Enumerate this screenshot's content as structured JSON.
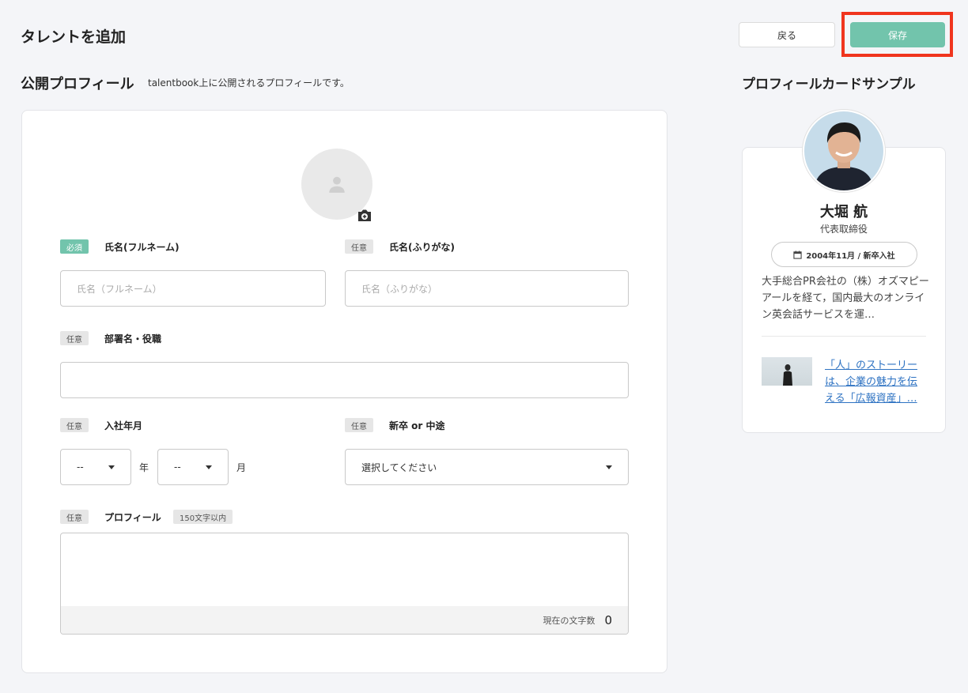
{
  "header": {
    "title": "タレントを追加",
    "back_label": "戻る",
    "save_label": "保存"
  },
  "section": {
    "title": "公開プロフィール",
    "description": "talentbook上に公開されるプロフィールです。"
  },
  "form": {
    "required_tag": "必須",
    "optional_tag": "任意",
    "name_label": "氏名(フルネーム)",
    "name_placeholder": "氏名（フルネーム）",
    "kana_label": "氏名(ふりがな)",
    "kana_placeholder": "氏名（ふりがな）",
    "dept_label": "部署名・役職",
    "dept_value": "",
    "join_label": "入社年月",
    "year_value": "--",
    "year_unit": "年",
    "month_value": "--",
    "month_unit": "月",
    "type_label": "新卒 or 中途",
    "type_value": "選択してください",
    "profile_label": "プロフィール",
    "profile_limit": "150文字以内",
    "char_count_label": "現在の文字数",
    "char_count": "0"
  },
  "sample": {
    "title": "プロフィールカードサンプル",
    "name": "大堀 航",
    "role": "代表取締役",
    "date": "2004年11月 / 新卒入社",
    "bio": "大手総合PR会社の（株）オズマピーアールを経て，国内最大のオンライン英会話サービスを運…",
    "link": "「人」のストーリーは、企業の魅力を伝える「広報資産」…"
  },
  "colors": {
    "accent": "#72c4ac",
    "highlight": "#f0351e",
    "link": "#2d72c2"
  }
}
